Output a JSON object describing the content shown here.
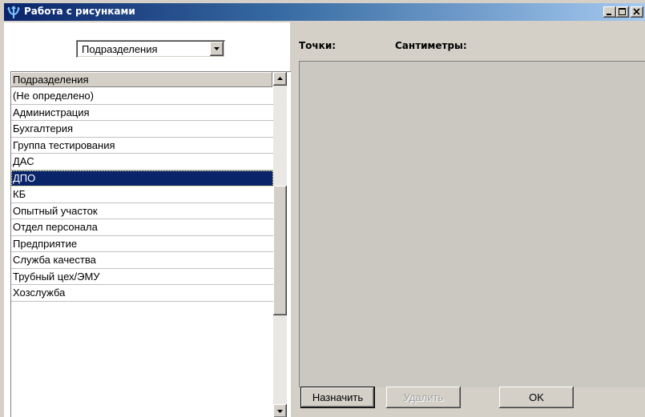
{
  "window": {
    "title": "Работа с рисунками"
  },
  "filter": {
    "selected": "Подразделения"
  },
  "list": {
    "header": "Подразделения",
    "items": [
      "(Не определено)",
      "Администрация",
      "Бухгалтерия",
      "Группа тестирования",
      "ДАС",
      "ДПО",
      "КБ",
      "Опытный участок",
      "Отдел персонала",
      "Предприятие",
      "Служба качества",
      "Трубный цех/ЭМУ",
      "Хозслужба"
    ],
    "selected_item": "ДПО"
  },
  "coords": {
    "points_label": "Точки:",
    "cm_label": "Сантиметры:"
  },
  "buttons": {
    "assign": "Назначить",
    "delete": "Удалить",
    "ok": "OK"
  },
  "colors": {
    "selection": "#0a246a",
    "titlebar": "#0a246a",
    "face": "#d4d0c8",
    "canvas": "#cbc8c1"
  },
  "icons": {
    "app": "trident-icon",
    "minimize": "minimize-icon",
    "maximize": "maximize-icon",
    "close": "close-icon"
  }
}
